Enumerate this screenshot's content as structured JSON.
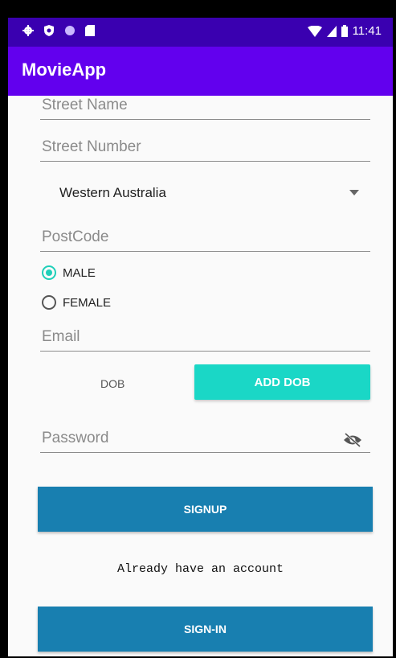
{
  "statusbar": {
    "time": "11:41"
  },
  "appbar": {
    "title": "MovieApp"
  },
  "form": {
    "street_name_placeholder": "Street Name",
    "street_number_placeholder": "Street Number",
    "state_selected": "Western Australia",
    "postcode_placeholder": "PostCode",
    "gender": {
      "options": [
        "MALE",
        "FEMALE"
      ],
      "selected": "MALE"
    },
    "email_placeholder": "Email",
    "dob_label": "DOB",
    "add_dob_button": "ADD DOB",
    "password_placeholder": "Password",
    "signup_button": "SIGNUP",
    "have_account_text": "Already have an account",
    "signin_button": "SIGN-IN"
  },
  "colors": {
    "statusbar": "#3a00b0",
    "appbar": "#6200ee",
    "accent": "#1ad7c6",
    "primary_button": "#187fb0"
  }
}
